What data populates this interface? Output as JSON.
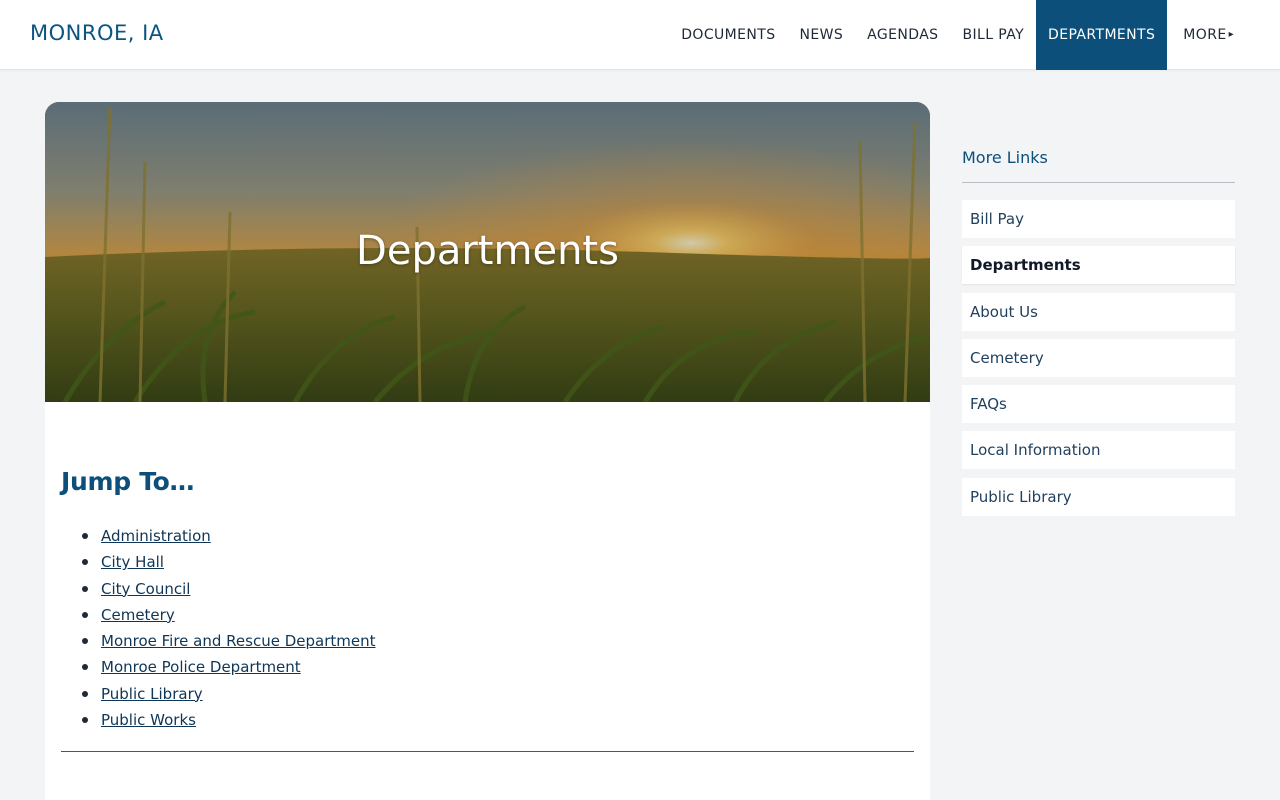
{
  "header": {
    "site_title": "MONROE, IA",
    "nav": [
      {
        "label": "DOCUMENTS"
      },
      {
        "label": "NEWS"
      },
      {
        "label": "AGENDAS"
      },
      {
        "label": "BILL PAY"
      },
      {
        "label": "DEPARTMENTS"
      },
      {
        "label": "MORE",
        "caret": "▸"
      }
    ],
    "active_nav": "DEPARTMENTS"
  },
  "hero": {
    "title": "Departments"
  },
  "main": {
    "jump_heading": "Jump To…",
    "jump_links": [
      "Administration",
      "City Hall",
      "City Council",
      "Cemetery",
      "Monroe Fire and Rescue Department",
      "Monroe Police Department",
      "Public Library",
      "Public Works"
    ]
  },
  "sidebar": {
    "title": "More Links",
    "links": [
      "Bill Pay",
      "Departments",
      "About Us",
      "Cemetery",
      "FAQs",
      "Local Information",
      "Public Library"
    ],
    "current": "Departments"
  },
  "colors": {
    "brand_blue": "#0b4f7a",
    "site_title": "#0b5680",
    "page_bg": "#f3f4f6",
    "card_bg": "#ffffff",
    "link": "#0f3656"
  },
  "icons": {
    "more_caret": "caret-right-icon",
    "list_bullet": "bullet-icon"
  }
}
